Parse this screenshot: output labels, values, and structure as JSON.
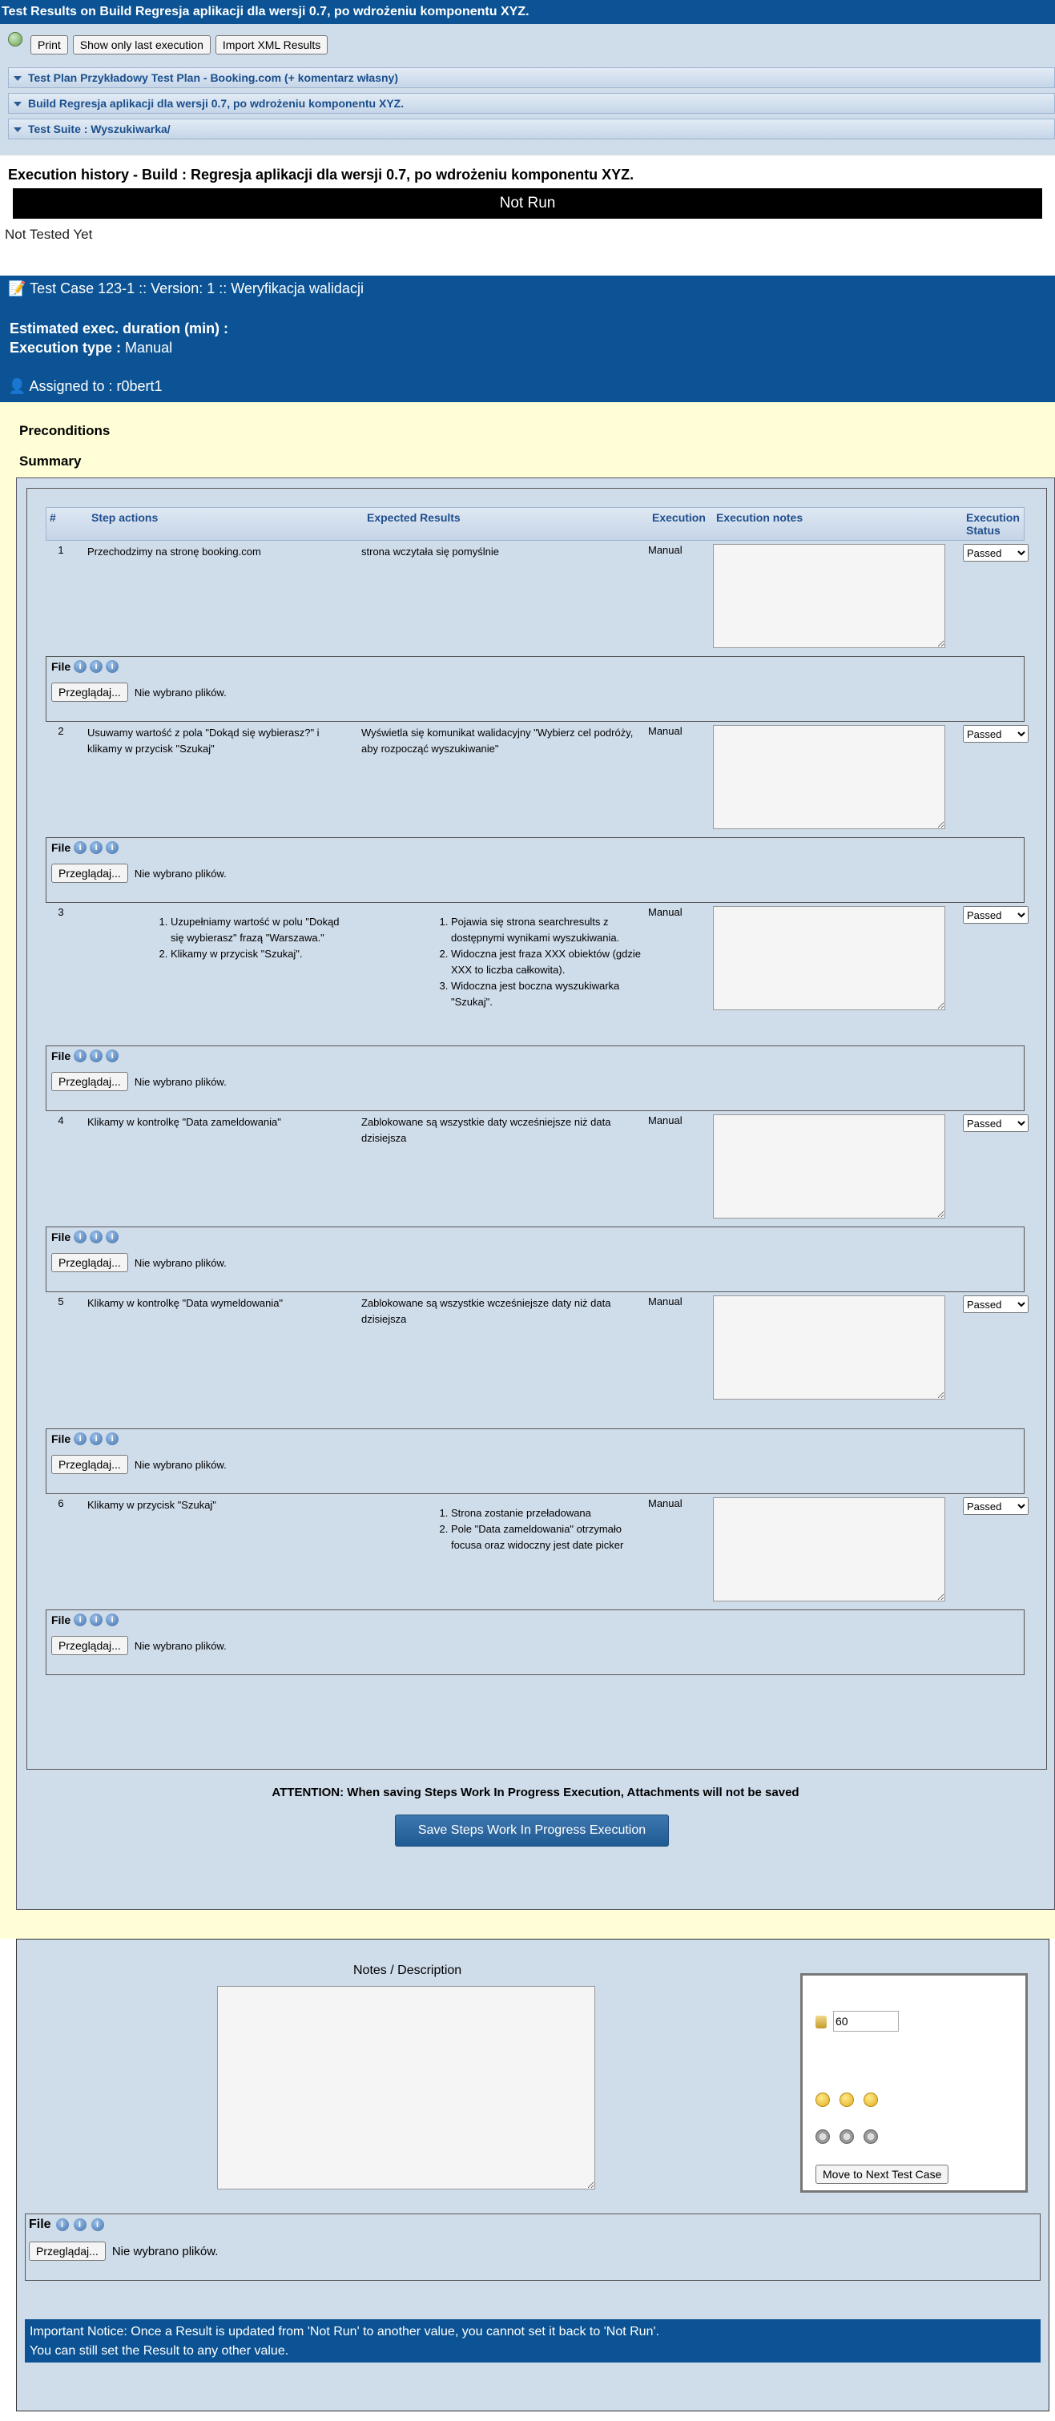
{
  "window_title": "Test Results on Build Regresja aplikacji dla wersji 0.7, po wdrożeniu komponentu XYZ.",
  "toolbar": {
    "print": "Print",
    "show_last": "Show only last execution",
    "import_xml": "Import XML Results"
  },
  "bars": {
    "test_plan": "Test Plan Przykładowy Test Plan - Booking.com (+ komentarz własny)",
    "build": "Build Regresja aplikacji dla wersji 0.7, po wdrożeniu komponentu XYZ.",
    "test_suite": "Test Suite : Wyszukiwarka/"
  },
  "history": {
    "title": "Execution history - Build : Regresja aplikacji dla wersji 0.7, po wdrożeniu komponentu XYZ.",
    "status": "Not Run",
    "not_tested": "Not Tested Yet"
  },
  "testcase": {
    "title": "Test Case 123-1 :: Version: 1 :: Weryfikacja walidacji",
    "duration_label": "Estimated exec. duration (min) :",
    "exec_type_label": "Execution type :",
    "exec_type": "Manual",
    "assigned": "Assigned to : r0bert1",
    "preconditions": "Preconditions",
    "summary": "Summary"
  },
  "steps_header": {
    "num": "#",
    "actions": "Step actions",
    "expected": "Expected Results",
    "execution": "Execution",
    "notes": "Execution notes",
    "status": "Execution Status"
  },
  "steps": [
    {
      "num": "1",
      "action": "Przechodzimy na stronę booking.com",
      "expected": "strona wczytała się pomyślnie",
      "exec": "Manual",
      "status": "Passed"
    },
    {
      "num": "2",
      "action": "Usuwamy wartość z pola \"Dokąd się wybierasz?\" i klikamy w przycisk \"Szukaj\"",
      "expected": "Wyświetla się komunikat walidacyjny \"Wybierz cel podróży, aby rozpocząć wyszukiwanie\"",
      "exec": "Manual",
      "status": "Passed"
    },
    {
      "num": "3",
      "action_list": [
        "Uzupełniamy wartość w polu \"Dokąd się wybierasz\" frazą \"Warszawa.\"",
        "Klikamy w przycisk \"Szukaj\"."
      ],
      "expected_list": [
        "Pojawia się strona searchresults z dostępnymi wynikami wyszukiwania.",
        "Widoczna jest fraza XXX obiektów (gdzie XXX to liczba całkowita).",
        "Widoczna jest boczna wyszukiwarka \"Szukaj\"."
      ],
      "exec": "Manual",
      "status": "Passed"
    },
    {
      "num": "4",
      "action": "Klikamy w kontrolkę \"Data zameldowania\"",
      "expected": "Zablokowane są wszystkie daty wcześniejsze niż data dzisiejsza",
      "exec": "Manual",
      "status": "Passed"
    },
    {
      "num": "5",
      "action": "Klikamy w kontrolkę \"Data wymeldowania\"",
      "expected": "Zablokowane są wszystkie wcześniejsze daty niż data dzisiejsza",
      "exec": "Manual",
      "status": "Passed"
    },
    {
      "num": "6",
      "action": "Klikamy w przycisk \"Szukaj\"",
      "expected_list": [
        "Strona zostanie przeładowana",
        "Pole \"Data zameldowania\" otrzymało focusa oraz widoczny jest date picker"
      ],
      "exec": "Manual",
      "status": "Passed"
    }
  ],
  "file": {
    "label": "File",
    "browse": "Przeglądaj...",
    "none": "Nie wybrano plików."
  },
  "attention": "ATTENTION: When saving Steps Work In Progress Execution, Attachments will not be saved",
  "save_button": "Save Steps Work In Progress Execution",
  "bottom": {
    "notes_label": "Notes / Description",
    "duration_value": "60",
    "move_next": "Move to Next Test Case"
  },
  "important": {
    "line1": "Important Notice: Once a Result is updated from 'Not Run' to another value, you cannot set it back to 'Not Run'.",
    "line2": "You can still set the Result to any other value."
  }
}
